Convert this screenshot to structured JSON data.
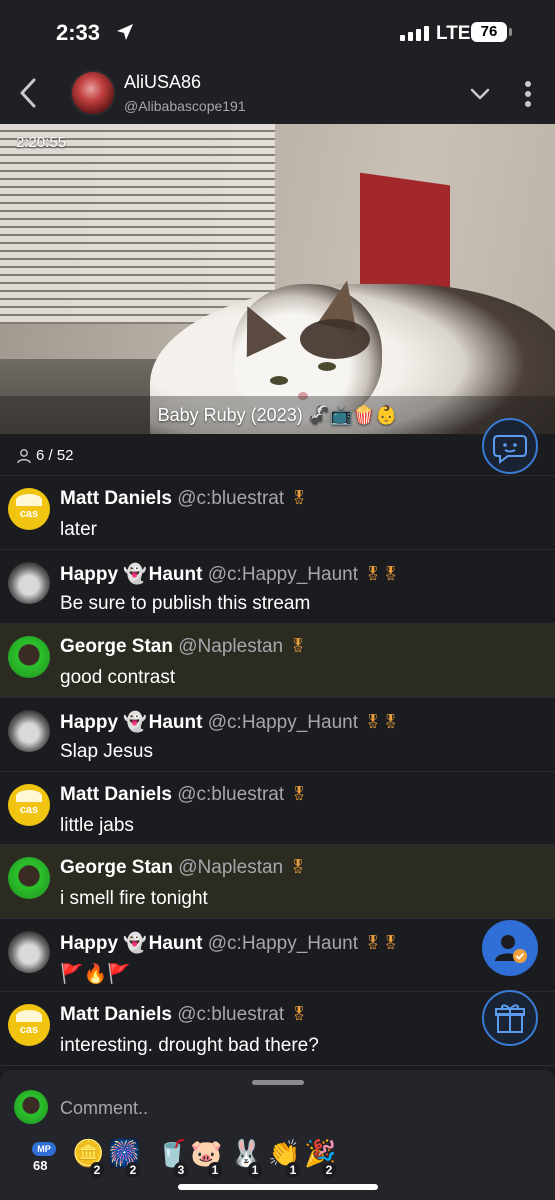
{
  "status_bar": {
    "time": "2:33",
    "network": "LTE",
    "battery": "76"
  },
  "header": {
    "channel_name": "AliUSA86",
    "channel_handle": "@Alibabascope191"
  },
  "video": {
    "timestamp": "2:20:55",
    "caption": "Baby Ruby (2023) 🦨📺🍿👶"
  },
  "viewers": {
    "count": "6 / 52"
  },
  "messages": [
    {
      "display": "Matt Daniels",
      "handle": "@c:bluestrat",
      "badge": "🎖",
      "text": "later",
      "avatar": "cas"
    },
    {
      "display_pre": "Happy",
      "ghost": "👻",
      "display_post": "Haunt",
      "handle": "@c:Happy_Haunt",
      "badge": "🎖🎖",
      "text": "Be sure to publish this stream",
      "avatar": "frank"
    },
    {
      "display": "George Stan",
      "handle": "@Naplestan",
      "badge": "🎖",
      "text": "good contrast",
      "avatar": "george",
      "highlight": true
    },
    {
      "display_pre": "Happy",
      "ghost": "👻",
      "display_post": "Haunt",
      "handle": "@c:Happy_Haunt",
      "badge": "🎖🎖",
      "text": "Slap Jesus",
      "avatar": "frank"
    },
    {
      "display": "Matt Daniels",
      "handle": "@c:bluestrat",
      "badge": "🎖",
      "text": "little jabs",
      "avatar": "cas"
    },
    {
      "display": "George Stan",
      "handle": "@Naplestan",
      "badge": "🎖",
      "text": "i smell fire tonight",
      "avatar": "george",
      "highlight": true
    },
    {
      "display_pre": "Happy",
      "ghost": "👻",
      "display_post": "Haunt",
      "handle": "@c:Happy_Haunt",
      "badge": "🎖🎖",
      "text": "🚩🔥🚩",
      "avatar": "frank"
    },
    {
      "display": "Matt Daniels",
      "handle": "@c:bluestrat",
      "badge": "🎖",
      "text": "interesting. drought bad there?",
      "avatar": "cas"
    }
  ],
  "comment": {
    "placeholder": "Comment.."
  },
  "reactions": {
    "mp_label": "MP",
    "mp_count": "68",
    "items": [
      {
        "icon": "coin-icon",
        "glyph": "🪙",
        "count": "2"
      },
      {
        "icon": "fireworks-icon",
        "glyph": "🎆",
        "count": "2"
      },
      {
        "icon": "cup-icon",
        "glyph": "🥤",
        "count": "3"
      },
      {
        "icon": "pig-icon",
        "glyph": "🐷",
        "count": "1"
      },
      {
        "icon": "bunny-icon",
        "glyph": "🐰",
        "count": "1"
      },
      {
        "icon": "clap-icon",
        "glyph": "👏",
        "count": "1"
      },
      {
        "icon": "party-icon",
        "glyph": "🎉",
        "count": "2"
      }
    ]
  },
  "colors": {
    "accent": "#2f6fd6",
    "background": "#1b1c20",
    "highlight_row": "#2b2b22",
    "badge": "#f0a13b"
  }
}
